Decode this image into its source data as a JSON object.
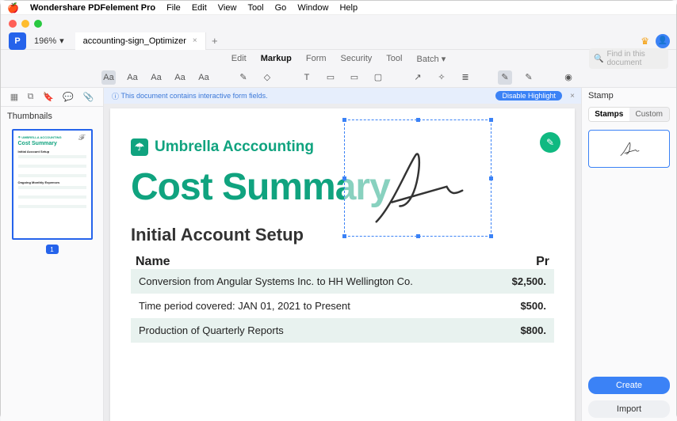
{
  "menubar": {
    "app": "Wondershare PDFelement Pro",
    "items": [
      "File",
      "Edit",
      "View",
      "Tool",
      "Go",
      "Window",
      "Help"
    ]
  },
  "tabbar": {
    "zoom": "196%",
    "filename": "accounting-sign_Optimizer",
    "newtab": "+"
  },
  "modes": {
    "items": [
      "Edit",
      "Markup",
      "Form",
      "Security",
      "Tool",
      "Batch"
    ],
    "active": 1,
    "batch_suffix": "▾",
    "search_placeholder": "Find in this document"
  },
  "toolrow": {
    "icons": [
      "Aa",
      "Aa",
      "Aa",
      "Aa",
      "Aa",
      "✎",
      "◇",
      "T",
      "▭",
      "▭",
      "▢",
      "↗",
      "✧",
      "≣",
      "✎",
      "✎",
      "◉"
    ]
  },
  "formfields_banner": {
    "info": "ⓘ",
    "text": "This document contains interactive form fields.",
    "pill": "Disable Highlight",
    "close": "×"
  },
  "thumbnails": {
    "title": "Thumbnails",
    "page_badge": "1"
  },
  "doc": {
    "brand_icon": "☂",
    "brand": "Umbrella Acccounting",
    "title": "Cost Summary",
    "section1": "Initial Account Setup",
    "thead": {
      "name": "Name",
      "price": "Pr"
    },
    "rows": [
      {
        "name": "Conversion from Angular Systems Inc. to HH Wellington Co.",
        "value": "$2,500."
      },
      {
        "name": "Time period covered: JAN 01, 2021 to Present",
        "value": "$500."
      },
      {
        "name": "Production of Quarterly Reports",
        "value": "$800."
      }
    ],
    "fab": "✎"
  },
  "stamps": {
    "title": "Stamp",
    "tab_on": "Stamps",
    "tab_off": "Custom",
    "create": "Create",
    "import": "Import"
  }
}
